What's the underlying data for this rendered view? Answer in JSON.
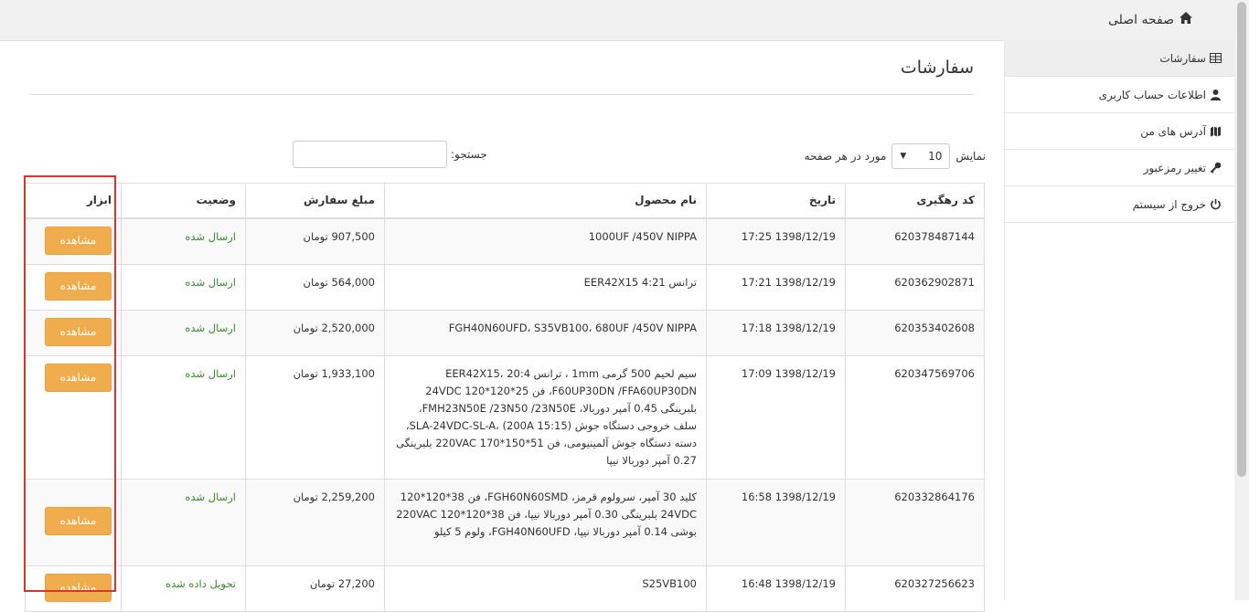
{
  "header": {
    "home_label": "صفحه اصلی"
  },
  "sidebar": {
    "items": [
      {
        "label": "سفارشات",
        "icon": "table-icon"
      },
      {
        "label": "اطلاعات حساب کاربری",
        "icon": "user-icon"
      },
      {
        "label": "آدرس های من",
        "icon": "map-icon"
      },
      {
        "label": "تغییر رمزعبور",
        "icon": "key-icon"
      },
      {
        "label": "خروج از سیستم",
        "icon": "power-icon"
      }
    ]
  },
  "main": {
    "title": "سفارشات",
    "length": {
      "prefix": "نمایش",
      "value": "10",
      "suffix": "مورد در هر صفحه"
    },
    "search": {
      "label": "جستجو:",
      "value": ""
    },
    "table": {
      "headers": [
        "کد رهگیری",
        "تاریخ",
        "نام محصول",
        "مبلغ سفارش",
        "وضعیت",
        "ابزار"
      ],
      "rows": [
        {
          "code": "620378487144",
          "date": "1398/12/19 17:25",
          "product": "1000UF /450V NIPPA",
          "amount": "907,500 تومان",
          "status": "ارسال شده",
          "action": "مشاهده"
        },
        {
          "code": "620362902871",
          "date": "1398/12/19 17:21",
          "product": "ترانس 4:21 EER42X15",
          "amount": "564,000 تومان",
          "status": "ارسال شده",
          "action": "مشاهده"
        },
        {
          "code": "620353402608",
          "date": "1398/12/19 17:18",
          "product": "FGH40N60UFD، S35VB100، 680UF /450V NIPPA",
          "amount": "2,520,000 تومان",
          "status": "ارسال شده",
          "action": "مشاهده"
        },
        {
          "code": "620347569706",
          "date": "1398/12/19 17:09",
          "product": "سیم لحیم 500 گرمی 1mm ، ترانس 20:4 EER42X15، F60UP30DN /FFA60UP30DN، فن 25*120*120 24VDC بلبرینگی 0.45 آمپر دوربالا، FMH23N50E /23N50 /23N50E، سلف خروجی دستگاه جوش SLA-24VDC-SL-A، (200A 15:15)، دسته دستگاه جوش آلمینیومی، فن 51*150*170 220VAC بلبرینگی 0.27 آمپر دوربالا نیپا",
          "amount": "1,933,100 تومان",
          "status": "ارسال شده",
          "action": "مشاهده"
        },
        {
          "code": "620332864176",
          "date": "1398/12/19 16:58",
          "product": "کلید 30 آمپر، سرولوم قرمز، FGH60N60SMD، فن 38*120*120 24VDC بلبرینگی 0.30 آمپر دوربالا نیپا، فن 38*120*120 220VAC بوشی 0.14 آمپر دوربالا نیپا، FGH40N60UFD، ولوم 5 کیلو",
          "amount": "2,259,200 تومان",
          "status": "ارسال شده",
          "action": "مشاهده"
        },
        {
          "code": "620327256623",
          "date": "1398/12/19 16:48",
          "product": "S25VB100",
          "amount": "27,200 تومان",
          "status": "تحویل داده شده",
          "action": "مشاهده"
        }
      ]
    }
  },
  "colors": {
    "accent_button": "#f0ad4e",
    "status_text": "#3c8a2f",
    "highlight": "#e03030"
  }
}
